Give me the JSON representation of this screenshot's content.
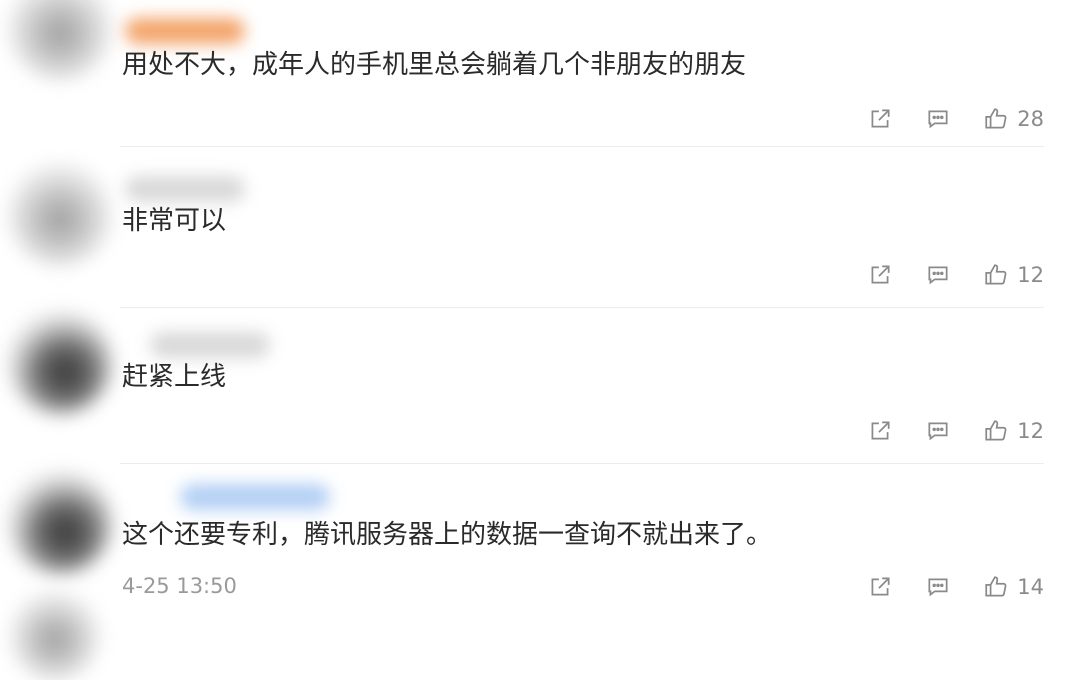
{
  "comments": [
    {
      "text": "用处不大，成年人的手机里总会躺着几个非朋友的朋友",
      "timestamp": "",
      "likes": "28"
    },
    {
      "text": "非常可以",
      "timestamp": "",
      "likes": "12"
    },
    {
      "text": "赶紧上线",
      "timestamp": "",
      "likes": "12"
    },
    {
      "text": "这个还要专利，腾讯服务器上的数据一查询不就出来了。",
      "timestamp": "4-25 13:50",
      "likes": "14"
    }
  ],
  "icons": {
    "share": "share-icon",
    "reply": "comment-icon",
    "like": "thumbs-up-icon"
  },
  "colors": {
    "text": "#2a2a2a",
    "meta": "#9a9a9a",
    "icon": "#8a8a8a",
    "divider": "#ececec"
  }
}
